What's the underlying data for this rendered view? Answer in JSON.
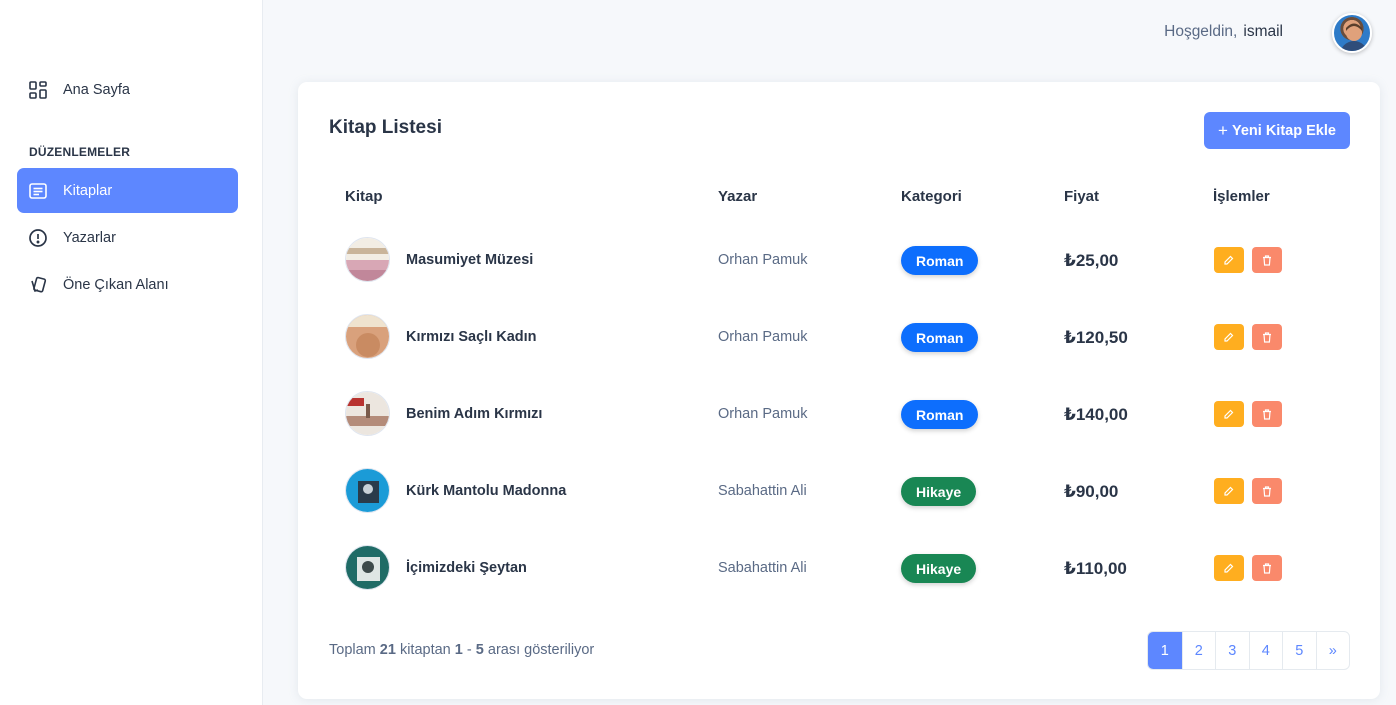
{
  "sidebar": {
    "items": [
      {
        "label": "Ana Sayfa",
        "icon": "dashboard-icon"
      },
      {
        "label": "Kitaplar",
        "icon": "book-list-icon",
        "active": true
      },
      {
        "label": "Yazarlar",
        "icon": "alert-circle-icon"
      },
      {
        "label": "Öne Çıkan Alanı",
        "icon": "cards-icon"
      }
    ],
    "section_title": "DÜZENLEMELER"
  },
  "header": {
    "welcome": "Hoşgeldin,",
    "username": "ismail"
  },
  "card": {
    "title": "Kitap Listesi",
    "add_button": "Yeni Kitap Ekle",
    "add_icon": "+"
  },
  "table": {
    "columns": [
      "Kitap",
      "Yazar",
      "Kategori",
      "Fiyat",
      "İşlemler"
    ],
    "rows": [
      {
        "title": "Masumiyet Müzesi",
        "author": "Orhan Pamuk",
        "category": "Roman",
        "price": "₺25,00"
      },
      {
        "title": "Kırmızı Saçlı Kadın",
        "author": "Orhan Pamuk",
        "category": "Roman",
        "price": "₺120,50"
      },
      {
        "title": "Benim Adım Kırmızı",
        "author": "Orhan Pamuk",
        "category": "Roman",
        "price": "₺140,00"
      },
      {
        "title": "Kürk Mantolu Madonna",
        "author": "Sabahattin Ali",
        "category": "Hikaye",
        "price": "₺90,00"
      },
      {
        "title": "İçimizdeki Şeytan",
        "author": "Sabahattin Ali",
        "category": "Hikaye",
        "price": "₺110,00"
      }
    ]
  },
  "footer": {
    "prefix": "Toplam",
    "total": "21",
    "middle": "kitaptan",
    "range_start": "1",
    "dash": "-",
    "range_end": "5",
    "suffix": "arası gösteriliyor"
  },
  "pagination": {
    "pages": [
      "1",
      "2",
      "3",
      "4",
      "5"
    ],
    "next": "»",
    "current": "1"
  },
  "colors": {
    "primary": "#5d87ff",
    "roman_badge": "#0d6efd",
    "hikaye_badge": "#198754",
    "edit": "#ffae1f",
    "delete": "#fa896b"
  }
}
